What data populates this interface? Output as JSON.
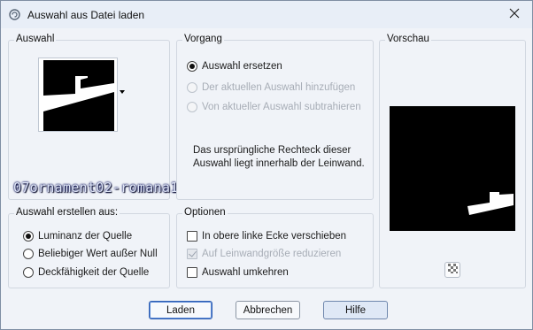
{
  "window": {
    "title": "Auswahl aus Datei laden",
    "icon": "spiral-app-icon",
    "close_icon": "close-icon"
  },
  "auswahl": {
    "group_label": "Auswahl",
    "watermark_text": "07ornament02-romana1",
    "dropdown_icon": "chevron-down-icon"
  },
  "vorgang": {
    "group_label": "Vorgang",
    "options": [
      {
        "label": "Auswahl ersetzen",
        "checked": true,
        "enabled": true
      },
      {
        "label": "Der aktuellen Auswahl hinzufügen",
        "checked": false,
        "enabled": false
      },
      {
        "label": "Von aktueller Auswahl subtrahieren",
        "checked": false,
        "enabled": false
      }
    ],
    "info_text": "Das ursprüngliche Rechteck dieser Auswahl liegt innerhalb der Leinwand."
  },
  "vorschau": {
    "group_label": "Vorschau",
    "checker_icon": "checkerboard-icon"
  },
  "erstellen": {
    "group_label": "Auswahl erstellen aus:",
    "options": [
      {
        "label": "Luminanz der Quelle",
        "checked": true
      },
      {
        "label": "Beliebiger Wert außer Null",
        "checked": false
      },
      {
        "label": "Deckfähigkeit der Quelle",
        "checked": false
      }
    ]
  },
  "optionen": {
    "group_label": "Optionen",
    "items": [
      {
        "label": "In obere linke Ecke verschieben",
        "checked": false,
        "enabled": true
      },
      {
        "label": "Auf Leinwandgröße reduzieren",
        "checked": true,
        "enabled": false
      },
      {
        "label": "Auswahl umkehren",
        "checked": false,
        "enabled": true
      }
    ]
  },
  "buttons": {
    "load": "Laden",
    "cancel": "Abbrechen",
    "help": "Hilfe"
  }
}
